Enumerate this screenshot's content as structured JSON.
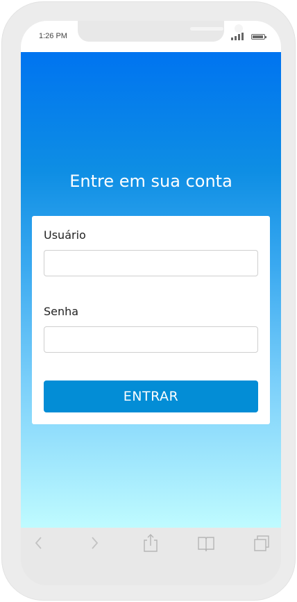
{
  "status_bar": {
    "time": "1:26 PM"
  },
  "login": {
    "title": "Entre em sua conta",
    "username_label": "Usuário",
    "username_value": "",
    "password_label": "Senha",
    "password_value": "",
    "submit_label": "ENTRAR"
  },
  "toolbar": {
    "icons": [
      "back-icon",
      "forward-icon",
      "share-icon",
      "bookmarks-icon",
      "tabs-icon"
    ]
  },
  "colors": {
    "gradient_top": "#0074f0",
    "gradient_bottom": "#bffbff",
    "button": "#038dd6"
  }
}
